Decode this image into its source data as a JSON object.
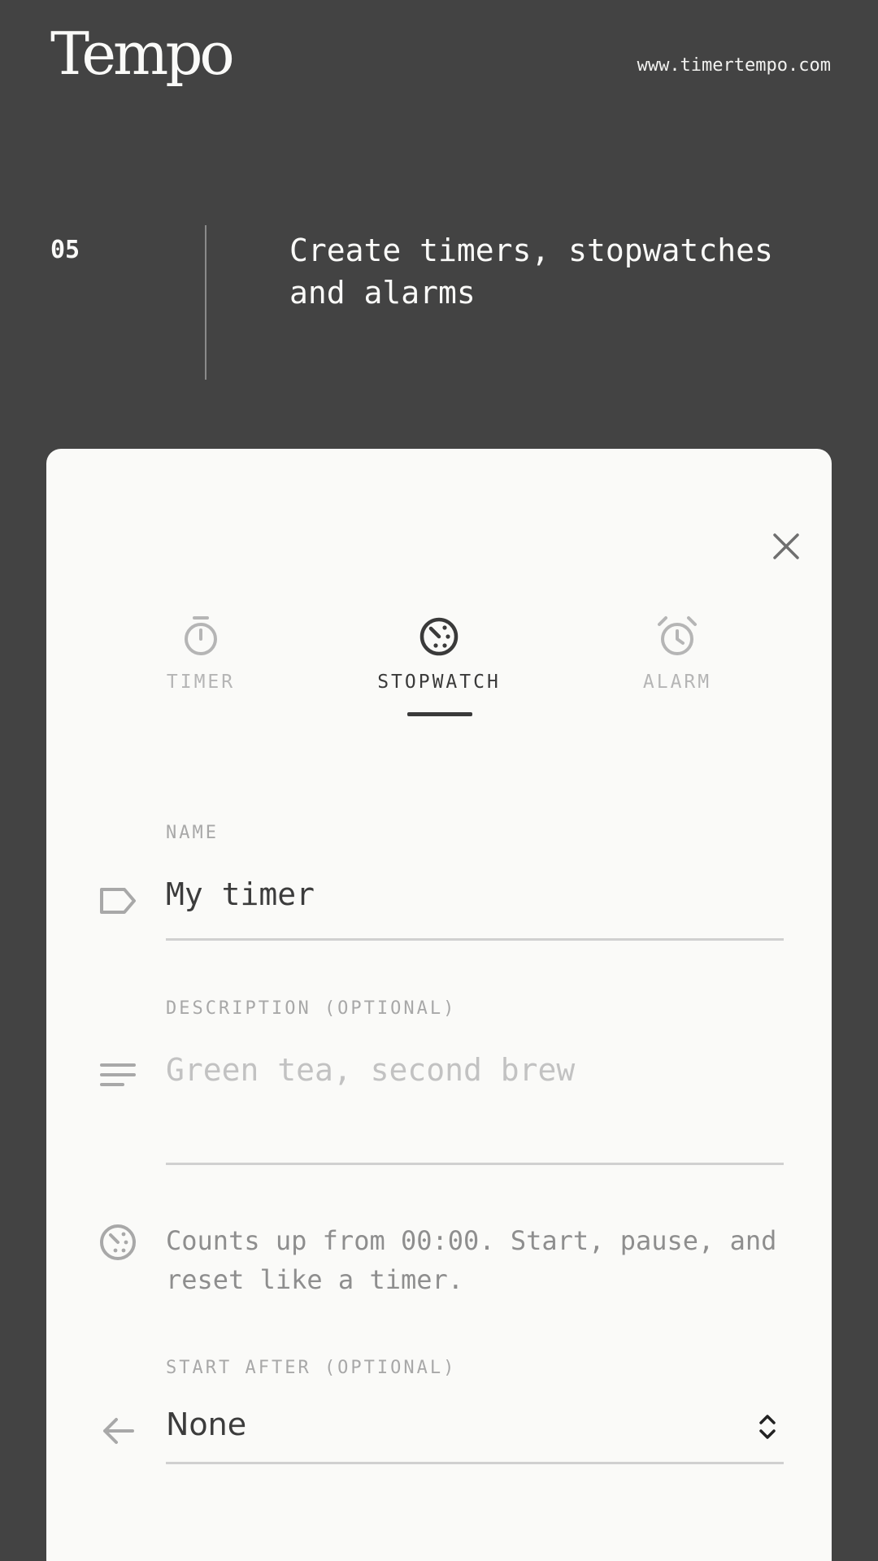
{
  "header": {
    "brand": "Tempo",
    "url": "www.timertempo.com"
  },
  "step": {
    "number": "05",
    "text": "Create timers, stopwatches and alarms"
  },
  "dialog": {
    "tabs": [
      {
        "label": "TIMER",
        "icon": "timer-icon",
        "active": false
      },
      {
        "label": "STOPWATCH",
        "icon": "stopwatch-icon",
        "active": true
      },
      {
        "label": "ALARM",
        "icon": "alarm-clock-icon",
        "active": false
      }
    ],
    "name": {
      "label": "NAME",
      "value": "My timer"
    },
    "description": {
      "label": "DESCRIPTION (OPTIONAL)",
      "placeholder": "Green tea, second brew"
    },
    "info": "Counts up from 00:00. Start, pause, and reset like a timer.",
    "start_after": {
      "label": "START AFTER (OPTIONAL)",
      "value": "None"
    }
  },
  "colors": {
    "background": "#434343",
    "card": "#fafaf8",
    "active": "#3a3a3a",
    "inactive": "#b5b5b5"
  }
}
